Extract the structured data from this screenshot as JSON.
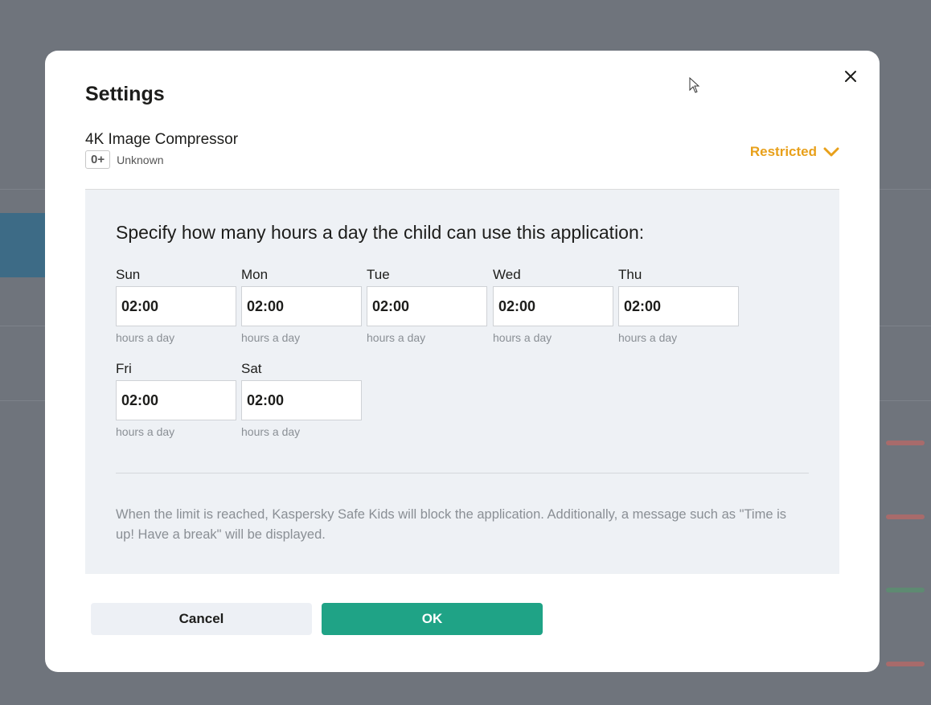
{
  "dialog": {
    "title": "Settings",
    "close_icon": "close-icon"
  },
  "app": {
    "name": "4K Image Compressor",
    "age_rating": "0+",
    "age_text": "Unknown",
    "status": "Restricted",
    "status_color": "#e8a01a"
  },
  "limits": {
    "instruction": "Specify how many hours a day the child can use this application:",
    "days": [
      {
        "label": "Sun",
        "value": "02:00",
        "hint": "hours a day"
      },
      {
        "label": "Mon",
        "value": "02:00",
        "hint": "hours a day"
      },
      {
        "label": "Tue",
        "value": "02:00",
        "hint": "hours a day"
      },
      {
        "label": "Wed",
        "value": "02:00",
        "hint": "hours a day"
      },
      {
        "label": "Thu",
        "value": "02:00",
        "hint": "hours a day"
      },
      {
        "label": "Fri",
        "value": "02:00",
        "hint": "hours a day"
      },
      {
        "label": "Sat",
        "value": "02:00",
        "hint": "hours a day"
      }
    ],
    "note": "When the limit is reached, Kaspersky Safe Kids will block the application. Additionally, a message such as \"Time is up! Have a break\" will be displayed."
  },
  "buttons": {
    "cancel": "Cancel",
    "ok": "OK",
    "ok_color": "#1fa386"
  }
}
